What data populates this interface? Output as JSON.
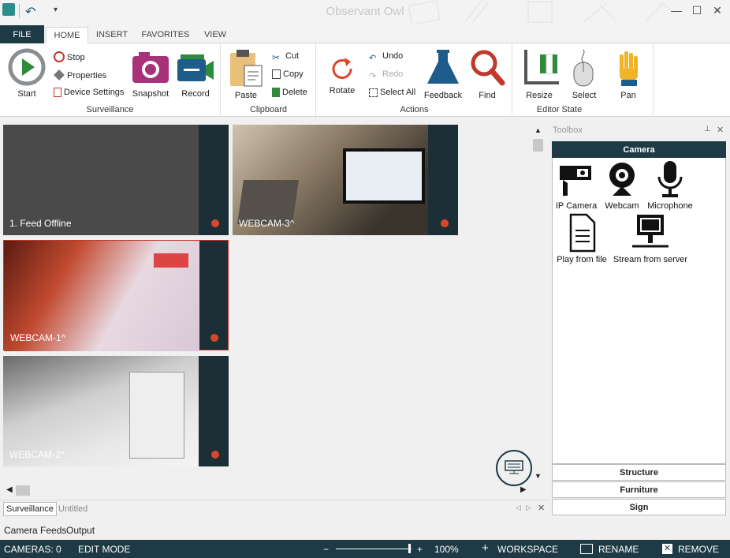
{
  "window": {
    "title": "Observant Owl",
    "controls": {
      "minimize": "—",
      "maximize": "☐",
      "close": "✕"
    }
  },
  "quick_access": {
    "undo": "↶",
    "dropdown": "▾"
  },
  "tabs": [
    {
      "label": "FILE"
    },
    {
      "label": "HOME"
    },
    {
      "label": "INSERT"
    },
    {
      "label": "FAVORITES"
    },
    {
      "label": "VIEW"
    }
  ],
  "ribbon": {
    "surveillance": {
      "label": "Surveillance",
      "start": "Start",
      "stop": "Stop",
      "properties": "Properties",
      "device_settings": "Device Settings",
      "snapshot": "Snapshot",
      "record": "Record"
    },
    "clipboard": {
      "label": "Clipboard",
      "paste": "Paste",
      "cut": "Cut",
      "copy": "Copy",
      "delete": "Delete"
    },
    "actions": {
      "label": "Actions",
      "rotate": "Rotate",
      "undo": "Undo",
      "redo": "Redo",
      "select_all": "Select All",
      "feedback": "Feedback",
      "find": "Find"
    },
    "editor_state": {
      "label": "Editor State",
      "resize": "Resize",
      "select": "Select",
      "pan": "Pan"
    }
  },
  "feeds": [
    {
      "label": "1. Feed Offline"
    },
    {
      "label": "WEBCAM-3^"
    },
    {
      "label": "WEBCAM-1^"
    },
    {
      "label": "WEBCAM-2^"
    }
  ],
  "doc_tabs": [
    {
      "label": "Surveillance"
    },
    {
      "label": "Untitled"
    }
  ],
  "output_tabs": [
    {
      "label": "Camera Feeds"
    },
    {
      "label": "Output"
    }
  ],
  "toolbox": {
    "title": "Toolbox",
    "categories": {
      "camera": "Camera",
      "structure": "Structure",
      "furniture": "Furniture",
      "sign": "Sign"
    },
    "tools": {
      "ip_camera": "IP Camera",
      "webcam": "Webcam",
      "microphone": "Microphone",
      "play_file": "Play from file",
      "stream_server": "Stream from server"
    }
  },
  "status": {
    "cameras": "CAMERAS: 0",
    "mode": "EDIT MODE",
    "zoom": "100%",
    "workspace": "WORKSPACE",
    "rename": "RENAME",
    "remove": "REMOVE"
  },
  "colors": {
    "accent": "#1e3a45",
    "record_dot": "#d9472b",
    "selection": "#c0392b"
  }
}
